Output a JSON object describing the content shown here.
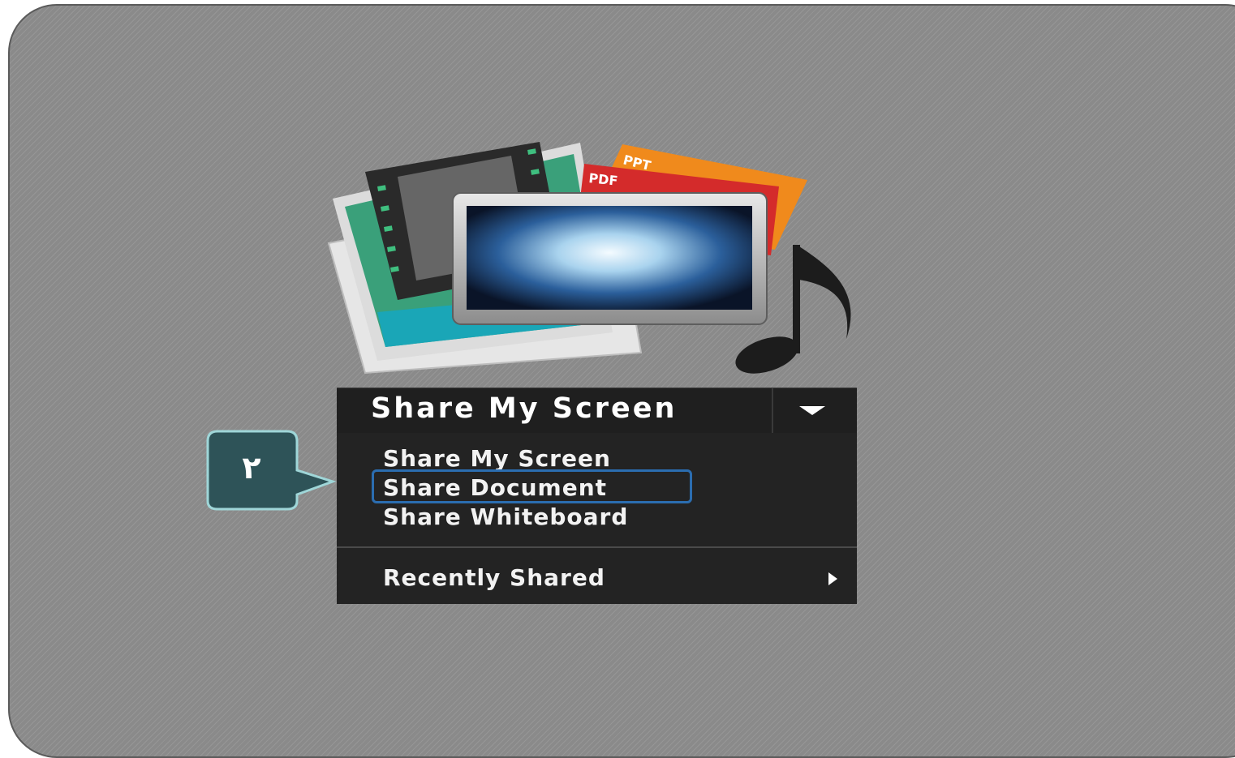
{
  "art": {
    "ppt_label": "PPT",
    "pdf_label": "PDF"
  },
  "share_button": {
    "label": "Share My Screen"
  },
  "menu": {
    "items": [
      {
        "label": "Share My Screen"
      },
      {
        "label": "Share Document",
        "highlighted": true
      },
      {
        "label": "Share Whiteboard"
      }
    ],
    "recently_shared": "Recently Shared"
  },
  "callout": {
    "number": "٢"
  },
  "colors": {
    "highlight": "#2b6db0",
    "callout_fill": "#2e5358",
    "callout_border": "#9fd6d8",
    "menu_bg": "#232323"
  }
}
